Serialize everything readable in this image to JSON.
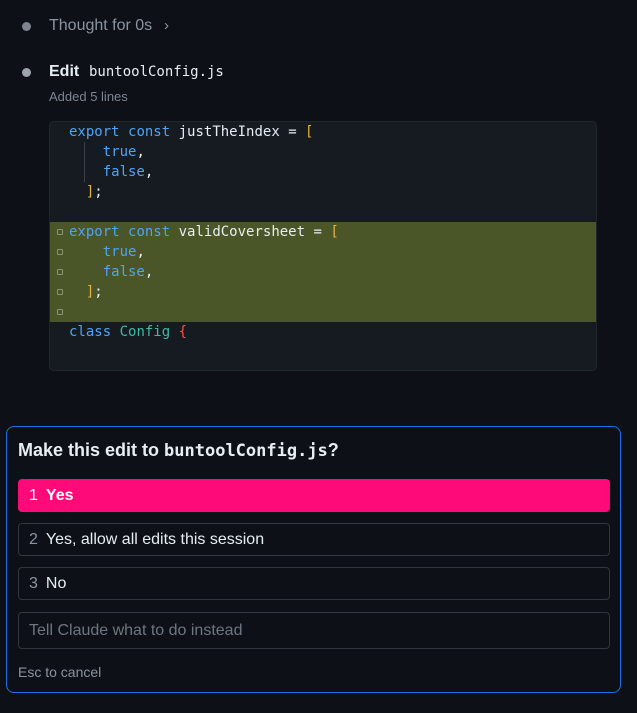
{
  "thought": {
    "label": "Thought for 0s",
    "chevron": "›"
  },
  "edit": {
    "title": "Edit",
    "filename": "buntoolConfig.js",
    "summary": "Added 5 lines"
  },
  "code": {
    "lines": [
      {
        "indent": "",
        "tokens": [
          [
            "kw",
            "export"
          ],
          [
            "id",
            " "
          ],
          [
            "kw",
            "const"
          ],
          [
            "id",
            " justTheIndex "
          ],
          [
            "punc",
            "= "
          ],
          [
            "br",
            "["
          ]
        ]
      },
      {
        "indent": "    ",
        "tokens": [
          [
            "bool",
            "true"
          ],
          [
            "punc",
            ","
          ]
        ]
      },
      {
        "indent": "    ",
        "tokens": [
          [
            "bool",
            "false"
          ],
          [
            "punc",
            ","
          ]
        ]
      },
      {
        "indent": "  ",
        "tokens": [
          [
            "br",
            "]"
          ],
          [
            "punc",
            ";"
          ]
        ]
      },
      {
        "indent": "",
        "tokens": []
      },
      {
        "indent": "",
        "added": true,
        "tokens": [
          [
            "kw",
            "export"
          ],
          [
            "id",
            " "
          ],
          [
            "kw",
            "const"
          ],
          [
            "id",
            " validCoversheet "
          ],
          [
            "punc",
            "= "
          ],
          [
            "br",
            "["
          ]
        ]
      },
      {
        "indent": "    ",
        "added": true,
        "tokens": [
          [
            "bool",
            "true"
          ],
          [
            "punc",
            ","
          ]
        ]
      },
      {
        "indent": "    ",
        "added": true,
        "tokens": [
          [
            "bool",
            "false"
          ],
          [
            "punc",
            ","
          ]
        ]
      },
      {
        "indent": "  ",
        "added": true,
        "tokens": [
          [
            "br",
            "]"
          ],
          [
            "punc",
            ";"
          ]
        ]
      },
      {
        "indent": "",
        "added": true,
        "tokens": []
      },
      {
        "indent": "",
        "tokens": [
          [
            "kw",
            "class"
          ],
          [
            "id",
            " "
          ],
          [
            "cls",
            "Config"
          ],
          [
            "id",
            " "
          ],
          [
            "red",
            "{"
          ]
        ]
      }
    ]
  },
  "dialog": {
    "title_prefix": "Make this edit to ",
    "title_file": "buntoolConfig.js",
    "title_suffix": "?",
    "options": [
      {
        "num": "1",
        "label": "Yes"
      },
      {
        "num": "2",
        "label": "Yes, allow all edits this session"
      },
      {
        "num": "3",
        "label": "No"
      }
    ],
    "input_placeholder": "Tell Claude what to do instead",
    "hint": "Esc to cancel"
  },
  "colors": {
    "accent": "#ff0a78",
    "dialog_border": "#1f6feb",
    "added_line_bg": "#4a5528"
  }
}
